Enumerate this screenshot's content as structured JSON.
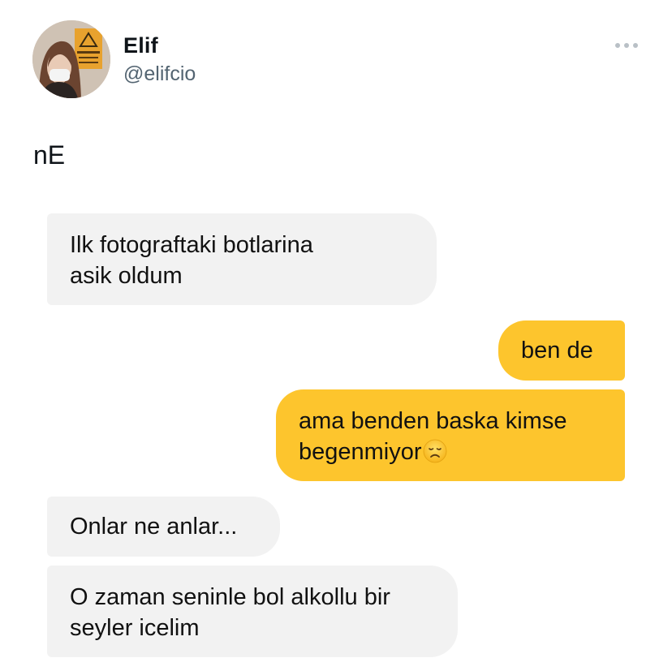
{
  "header": {
    "display_name": "Elif",
    "handle": "@elifcio",
    "avatar_icon": "profile-photo-avatar",
    "more_icon": "more-horizontal-icon"
  },
  "tweet": {
    "text": "nE"
  },
  "chat": {
    "incoming_color": "#f2f2f2",
    "outgoing_color": "#fdc52d",
    "messages": [
      {
        "side": "incoming",
        "lines": [
          "Ilk fotograftaki botlarina",
          "asik oldum"
        ]
      },
      {
        "side": "outgoing",
        "lines": [
          "ben de"
        ]
      },
      {
        "side": "outgoing",
        "lines": [
          "ama benden baska kimse",
          "begenmiyor"
        ],
        "emoji": "disappointed-face-emoji"
      },
      {
        "side": "incoming",
        "lines": [
          "Onlar ne anlar..."
        ]
      },
      {
        "side": "incoming",
        "lines": [
          "O zaman seninle bol alkollu bir",
          "seyler icelim"
        ]
      }
    ]
  }
}
